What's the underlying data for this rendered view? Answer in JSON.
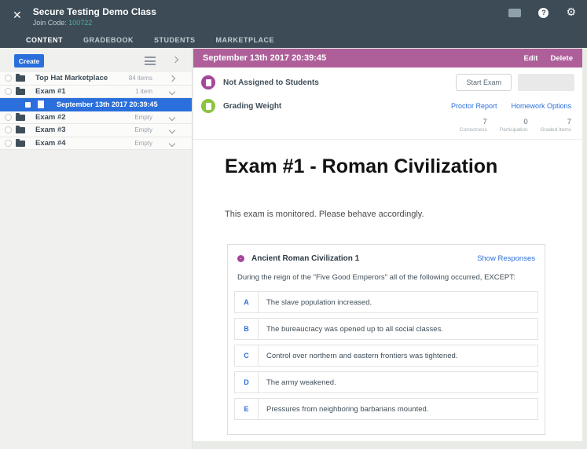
{
  "topbar": {
    "close": "✕",
    "title": "Secure Testing Demo Class",
    "join_code_label": "Join Code:",
    "join_code": "100722",
    "help": "?",
    "gear": "⚙",
    "tabs": [
      {
        "label": "CONTENT"
      },
      {
        "label": "GRADEBOOK"
      },
      {
        "label": "STUDENTS"
      },
      {
        "label": "MARKETPLACE"
      }
    ]
  },
  "sidebar": {
    "create_label": "Create",
    "items": [
      {
        "label": "Top Hat Marketplace",
        "meta": "84 items"
      },
      {
        "label": "Exam #1",
        "meta": "1 item"
      },
      {
        "label": "September 13th 2017 20:39:45",
        "meta": ""
      },
      {
        "label": "Exam #2",
        "meta": "Empty"
      },
      {
        "label": "Exam #3",
        "meta": "Empty"
      },
      {
        "label": "Exam #4",
        "meta": "Empty"
      }
    ]
  },
  "main": {
    "header": {
      "title": "September 13th 2017 20:39:45",
      "edit": "Edit",
      "delete": "Delete"
    },
    "status": {
      "label": "Not Assigned to Students",
      "start_exam": "Start Exam"
    },
    "grading": {
      "label": "Grading Weight",
      "proctor_report": "Proctor Report",
      "homework_options": "Homework Options"
    },
    "stats": [
      {
        "value": "7",
        "label": "Correctness"
      },
      {
        "value": "0",
        "label": "Participation"
      },
      {
        "value": "7",
        "label": "Graded Items"
      }
    ],
    "exam": {
      "title": "Exam #1 - Roman Civilization",
      "notice": "This exam is monitored. Please behave accordingly.",
      "question": {
        "title": "Ancient Roman Civilization 1",
        "show_responses": "Show Responses",
        "prompt": "During the reign of the \"Five Good Emperors\" all of the following occurred, EXCEPT:",
        "options": [
          {
            "letter": "A",
            "text": "The slave population increased."
          },
          {
            "letter": "B",
            "text": "The bureaucracy was opened up to all social classes."
          },
          {
            "letter": "C",
            "text": "Control over northern and eastern frontiers was tightened."
          },
          {
            "letter": "D",
            "text": "The army weakened."
          },
          {
            "letter": "E",
            "text": "Pressures from neighboring barbarians mounted."
          }
        ]
      }
    }
  },
  "colors": {
    "topbar_bg": "#3c4b55",
    "accent_teal": "#49b3a2",
    "brand_blue": "#2a6fdb",
    "header_purple": "#ae5f9a",
    "icon_purple": "#a5469b",
    "icon_green": "#8bc540"
  }
}
